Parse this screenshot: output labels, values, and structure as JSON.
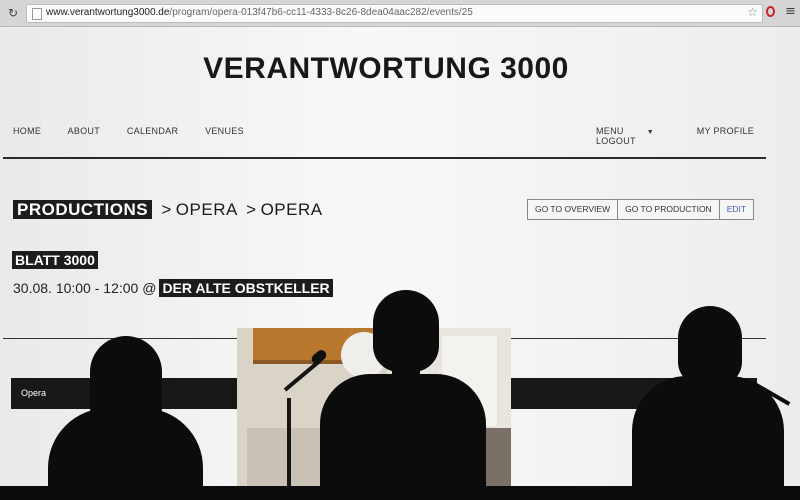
{
  "browser": {
    "url_domain": "www.verantwortung3000.de",
    "url_path": "/program/opera-013f47b6-cc11-4333-8c26-8dea04aac282/events/25"
  },
  "site": {
    "title": "VERANTWORTUNG 3000",
    "nav_left": [
      "HOME",
      "ABOUT",
      "CALENDAR",
      "VENUES"
    ],
    "nav_right": {
      "menu": "MENU",
      "profile": "MY PROFILE",
      "logout": "LOGOUT"
    }
  },
  "breadcrumb": {
    "root": "PRODUCTIONS",
    "sep1": ">",
    "level1": "OPERA",
    "sep2": ">",
    "level2": "OPERA"
  },
  "actions": {
    "overview": "GO TO OVERVIEW",
    "production": "GO TO PRODUCTION",
    "edit": "EDIT"
  },
  "event": {
    "name": "BLATT 3000",
    "datetime": "30.08. 10:00 - 12:00 @",
    "venue": "DER ALTE OBSTKELLER"
  },
  "section": {
    "label": "Opera"
  },
  "icons": [
    "reload-icon",
    "page-icon",
    "star-icon",
    "opera-icon",
    "menu-icon",
    "caret-down-icon"
  ]
}
